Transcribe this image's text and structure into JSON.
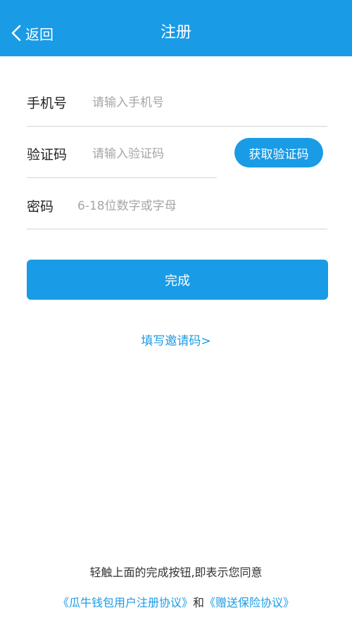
{
  "header": {
    "back_label": "返回",
    "title": "注册"
  },
  "form": {
    "phone": {
      "label": "手机号",
      "placeholder": "请输入手机号"
    },
    "code": {
      "label": "验证码",
      "placeholder": "请输入验证码",
      "button_label": "获取验证码"
    },
    "password": {
      "label": "密码",
      "placeholder": "6-18位数字或字母"
    }
  },
  "submit_label": "完成",
  "invite_link": "填写邀请码>",
  "footer": {
    "note": "轻触上面的完成按钮,即表示您同意",
    "agreement_link": "《瓜牛钱包用户注册协议》",
    "conjunction": "和",
    "insurance_link": "《赠送保险协议》"
  },
  "colors": {
    "accent": "#1a9be6",
    "background": "#ffffff",
    "divider": "#d4d4d4"
  },
  "icons": {
    "back": "chevron-left-icon"
  }
}
